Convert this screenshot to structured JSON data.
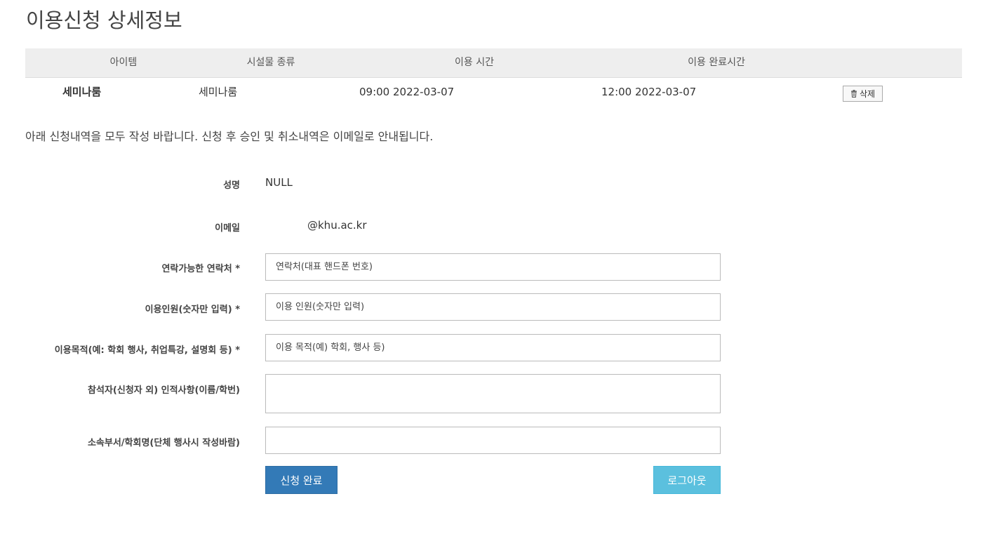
{
  "page": {
    "title": "이용신청 상세정보"
  },
  "table": {
    "headers": [
      "아이템",
      "시설물 종류",
      "이용 시간",
      "이용 완료시간"
    ],
    "rows": [
      {
        "item": "세미나룸",
        "facility": "세미나룸",
        "start_time": "09:00 2022-03-07",
        "end_time": "12:00 2022-03-07",
        "delete_label": "삭제",
        "delete_icon": "trash-icon"
      }
    ]
  },
  "notice": "아래 신청내역을 모두 작성 바랍니다. 신청 후 승인 및 취소내역은 이메일로 안내됩니다.",
  "form": {
    "name_label": "성명",
    "name_value": "NULL",
    "email_label": "이메일",
    "email_value": "@khu.ac.kr",
    "contact_label": "연락가능한 연락처 *",
    "contact_placeholder": "연락처(대표 핸드폰 번호)",
    "people_label": "이용인원(숫자만 입력) *",
    "people_placeholder": "이용 인원(숫자만 입력)",
    "purpose_label": "이용목적(예: 학회 행사, 취업특강, 설명회 등) *",
    "purpose_placeholder": "이용 목적(예) 학회, 행사 등)",
    "attendees_label": "참석자(신청자 외) 인적사항(이름/학번)",
    "attendees_value": "",
    "department_label": "소속부서/학회명(단체 행사시 작성바람)",
    "department_value": ""
  },
  "buttons": {
    "submit_label": "신청 완료",
    "logout_label": "로그아웃"
  },
  "colors": {
    "primary": "#337ab7",
    "info": "#5bc0de",
    "table_header_bg": "#eeeeee"
  }
}
